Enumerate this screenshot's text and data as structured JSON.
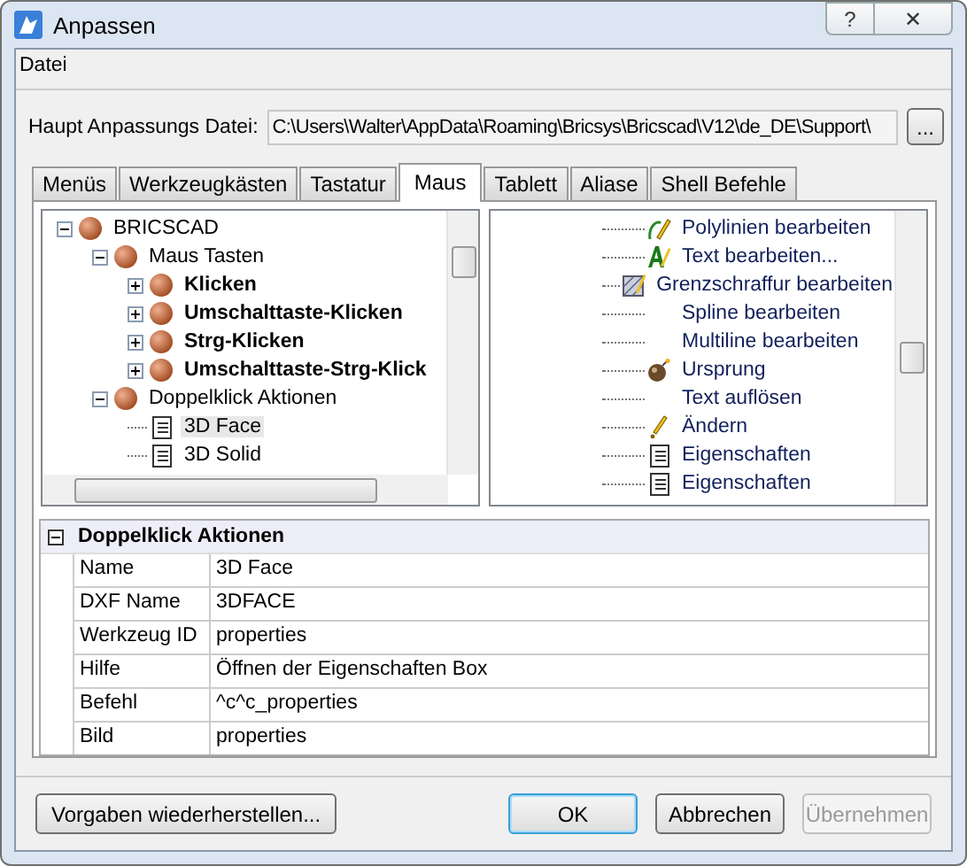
{
  "window": {
    "title": "Anpassen",
    "help_button": "?",
    "close_button": "✕"
  },
  "file_group": {
    "label": "Datei",
    "path_label": "Haupt Anpassungs Datei:",
    "path_value": "C:\\Users\\Walter\\AppData\\Roaming\\Bricsys\\Bricscad\\V12\\de_DE\\Support\\",
    "browse_button": "..."
  },
  "tabs": [
    {
      "label": "Menüs",
      "selected": false
    },
    {
      "label": "Werkzeugkästen",
      "selected": false
    },
    {
      "label": "Tastatur",
      "selected": false
    },
    {
      "label": "Maus",
      "selected": true
    },
    {
      "label": "Tablett",
      "selected": false
    },
    {
      "label": "Aliase",
      "selected": false
    },
    {
      "label": "Shell Befehle",
      "selected": false
    }
  ],
  "left_tree": [
    {
      "label": "BRICSCAD",
      "kind": "sphere",
      "bold": false,
      "selected": false,
      "expanded": true,
      "children": [
        {
          "label": "Maus Tasten",
          "kind": "sphere",
          "bold": false,
          "selected": false,
          "expanded": true,
          "children": [
            {
              "label": "Klicken",
              "kind": "sphere",
              "bold": true,
              "selected": false,
              "expanded": false
            },
            {
              "label": "Umschalttaste-Klicken",
              "kind": "sphere",
              "bold": true,
              "selected": false,
              "expanded": false
            },
            {
              "label": "Strg-Klicken",
              "kind": "sphere",
              "bold": true,
              "selected": false,
              "expanded": false
            },
            {
              "label": "Umschalttaste-Strg-Klick",
              "kind": "sphere",
              "bold": true,
              "selected": false,
              "expanded": false
            }
          ]
        },
        {
          "label": "Doppelklick Aktionen",
          "kind": "sphere",
          "bold": false,
          "selected": false,
          "expanded": true,
          "children": [
            {
              "label": "3D Face",
              "kind": "document",
              "bold": false,
              "selected": true
            },
            {
              "label": "3D Solid",
              "kind": "document",
              "bold": false,
              "selected": false
            }
          ]
        }
      ]
    }
  ],
  "right_list": [
    {
      "label": "Polylinien bearbeiten",
      "kind": "pencil"
    },
    {
      "label": "Text bearbeiten...",
      "kind": "text-pencil"
    },
    {
      "label": "Grenzschraffur bearbeiten",
      "kind": "hatch"
    },
    {
      "label": "Spline bearbeiten",
      "kind": "none"
    },
    {
      "label": "Multiline bearbeiten",
      "kind": "none"
    },
    {
      "label": "Ursprung",
      "kind": "bomb"
    },
    {
      "label": "Text auflösen",
      "kind": "none"
    },
    {
      "label": "Ändern",
      "kind": "exclaim"
    },
    {
      "label": "Eigenschaften",
      "kind": "document"
    },
    {
      "label": "Eigenschaften",
      "kind": "document"
    }
  ],
  "properties": {
    "title": "Doppelklick Aktionen",
    "expanded": true,
    "rows": [
      {
        "name": "Name",
        "value": "3D Face"
      },
      {
        "name": "DXF Name",
        "value": "3DFACE"
      },
      {
        "name": "Werkzeug ID",
        "value": "properties"
      },
      {
        "name": "Hilfe",
        "value": "Öffnen der Eigenschaften Box"
      },
      {
        "name": "Befehl",
        "value": "^c^c_properties"
      },
      {
        "name": "Bild",
        "value": "properties"
      }
    ]
  },
  "buttons": [
    {
      "label": "Vorgaben wiederherstellen...",
      "kind": "left",
      "disabled": false,
      "default": false
    },
    {
      "label": "OK",
      "kind": "right",
      "disabled": false,
      "default": true
    },
    {
      "label": "Abbrechen",
      "kind": "right",
      "disabled": false,
      "default": false
    },
    {
      "label": "Übernehmen",
      "kind": "right",
      "disabled": true,
      "default": false
    }
  ]
}
